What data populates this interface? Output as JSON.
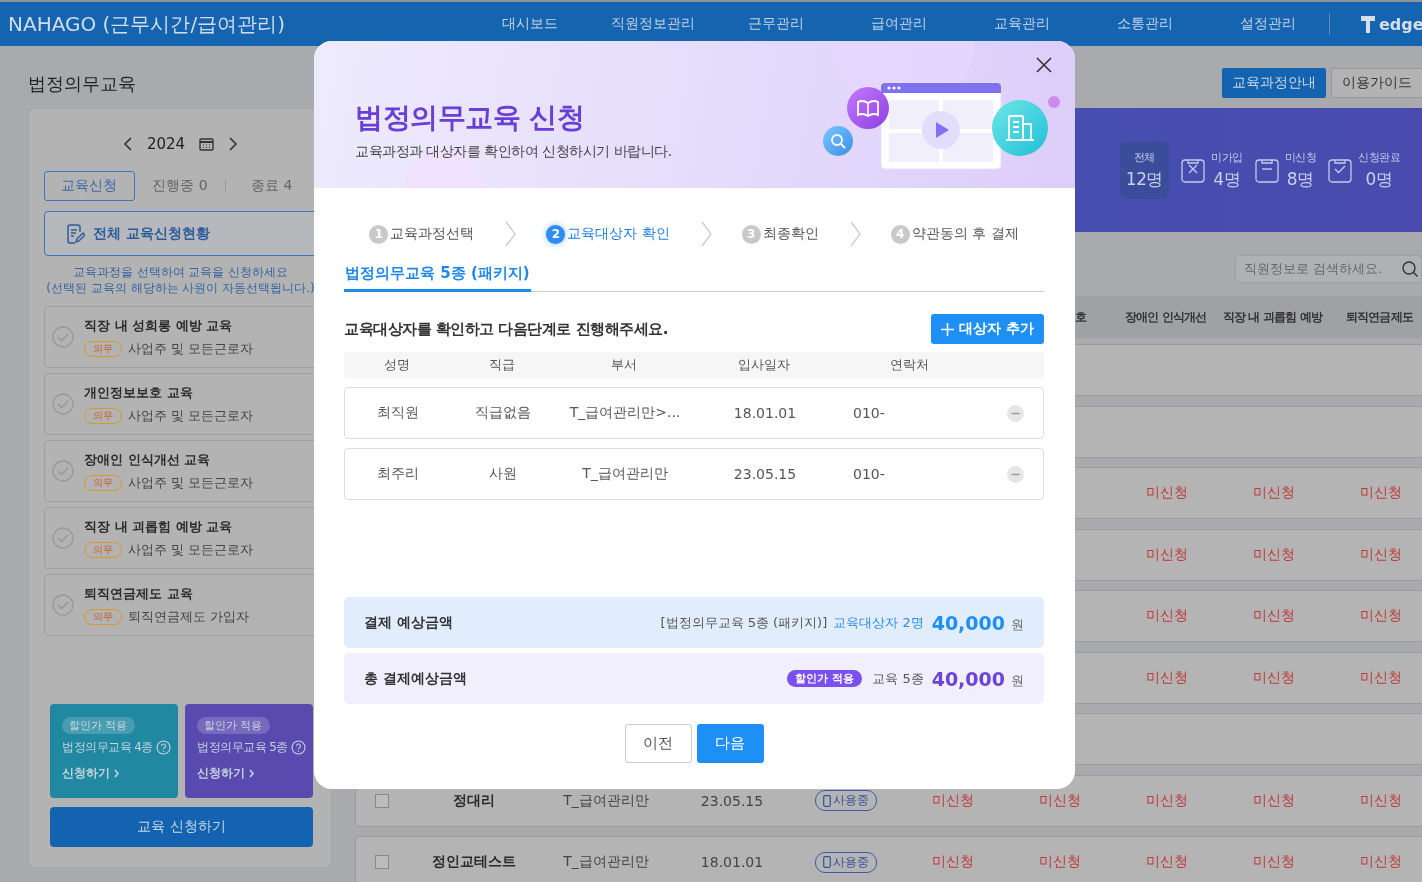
{
  "header": {
    "brand": "NAHAGO (근무시간/급여관리)",
    "nav": [
      "대시보드",
      "직원정보관리",
      "근무관리",
      "급여관리",
      "교육관리",
      "소통관리",
      "설정관리"
    ],
    "logo_text": "edge"
  },
  "page_title": "법정의무교육",
  "left_panel": {
    "year": "2024",
    "tabs": [
      {
        "label": "교육신청",
        "selected": true
      },
      {
        "label": "진행중 0",
        "selected": false
      },
      {
        "label": "종료 4",
        "selected": false
      }
    ],
    "status_button": "전체 교육신청현황",
    "notice": [
      "교육과정을 선택하여 교육을 신청하세요",
      "(선택된 교육의 해당하는 사원이 자동선택됩니다.)"
    ],
    "courses": [
      {
        "title": "직장 내 성희롱 예방 교육",
        "badge": "의무",
        "target": "사업주 및 모든근로자",
        "checked": false
      },
      {
        "title": "개인정보보호 교육",
        "badge": "의무",
        "target": "사업주 및 모든근로자",
        "checked": false
      },
      {
        "title": "장애인 인식개선 교육",
        "badge": "의무",
        "target": "사업주 및 모든근로자",
        "checked": false
      },
      {
        "title": "직장 내 괴롭힘 예방 교육",
        "badge": "의무",
        "target": "사업주 및 모든근로자",
        "checked": false
      },
      {
        "title": "퇴직연금제도 교육",
        "badge": "의무",
        "target": "퇴직연금제도 가입자",
        "checked": false
      }
    ],
    "packages": [
      {
        "badge": "할인가 적용",
        "title": "법정의무교육 4종",
        "link": "신청하기",
        "color": "#2088a0"
      },
      {
        "badge": "할인가 적용",
        "title": "법정의무교육 5종",
        "link": "신청하기",
        "color": "#5a4ab0"
      }
    ],
    "apply_button": "교육 신청하기"
  },
  "top_buttons": [
    {
      "label": "교육과정안내",
      "kind": "primary"
    },
    {
      "label": "이용가이드",
      "kind": "secondary"
    }
  ],
  "stats": [
    {
      "kind": "total",
      "label": "전체",
      "value": "12명",
      "selected": true
    },
    {
      "kind": "not_joined",
      "label": "미가입",
      "value": "4명",
      "selected": false
    },
    {
      "kind": "not_applied",
      "label": "미신청",
      "value": "8명",
      "selected": false
    },
    {
      "kind": "done",
      "label": "신청완료",
      "value": "0명",
      "selected": false
    }
  ],
  "search": {
    "placeholder": "직원정보로 검색하세요."
  },
  "table": {
    "columns": [
      {
        "label": "호",
        "clipped": true
      },
      {
        "label": "장애인 인식개선",
        "clipped": false
      },
      {
        "label": "직장 내 괴롭힘 예방",
        "clipped": false
      },
      {
        "label": "퇴직연금제도",
        "clipped": false
      }
    ],
    "rows": [
      {},
      {},
      {
        "trainings": [
          "미신청",
          "미신청",
          "미신청"
        ]
      },
      {
        "trainings": [
          "미신청",
          "미신청",
          "미신청"
        ]
      },
      {
        "trainings": [
          "미신청",
          "미신청",
          "미신청"
        ]
      },
      {
        "trainings": [
          "미신청",
          "미신청",
          "미신청"
        ]
      },
      {},
      {
        "checked": false,
        "name": "정대리",
        "department": "T_급여관리만",
        "hire_date": "23.05.15",
        "status": "사용중",
        "trainings": [
          "미신청",
          "미신청",
          "미신청",
          "미신청",
          "미신청"
        ]
      },
      {
        "checked": false,
        "name": "정인교테스트",
        "department": "T_급여관리만",
        "hire_date": "18.01.01",
        "status": "사용중",
        "trainings": [
          "미신청",
          "미신청",
          "미신청",
          "미신청",
          "미신청"
        ]
      }
    ]
  },
  "modal": {
    "title": "법정의무교육 신청",
    "subtitle": "교육과정과 대상자를 확인하여 신청하시기 바랍니다.",
    "steps": [
      {
        "number": "1",
        "label": "교육과정선택",
        "selected": false
      },
      {
        "number": "2",
        "label": "교육대상자 확인",
        "selected": true
      },
      {
        "number": "3",
        "label": "최종확인",
        "selected": false
      },
      {
        "number": "4",
        "label": "약관동의 후 결제",
        "selected": false
      }
    ],
    "tab": {
      "label": "법정의무교육 5종 (패키지)",
      "selected": true
    },
    "instruction": "교육대상자를 확인하고 다음단계로 진행해주세요.",
    "add_button": "대상자 추가",
    "columns": [
      "성명",
      "직급",
      "부서",
      "입사일자",
      "연락처"
    ],
    "rows": [
      {
        "cells": [
          "최직원",
          "직급없음",
          "T_급여관리만>...",
          "18.01.01",
          "010-"
        ]
      },
      {
        "cells": [
          "최주리",
          "사원",
          "T_급여관리만",
          "23.05.15",
          "010-"
        ]
      }
    ],
    "summary": [
      {
        "kind": "estimate",
        "label": "결제 예상금액",
        "detail": "[법정의무교육 5종 (패키지)]",
        "count": "교육대상자 2명",
        "amount": "40,000",
        "unit": "원"
      },
      {
        "kind": "total",
        "label": "총 결제예상금액",
        "badge": "할인가 적용",
        "detail": "교육 5종",
        "amount": "40,000",
        "unit": "원"
      }
    ],
    "buttons": [
      {
        "label": "이전",
        "kind": "secondary"
      },
      {
        "label": "다음",
        "kind": "primary"
      }
    ]
  }
}
